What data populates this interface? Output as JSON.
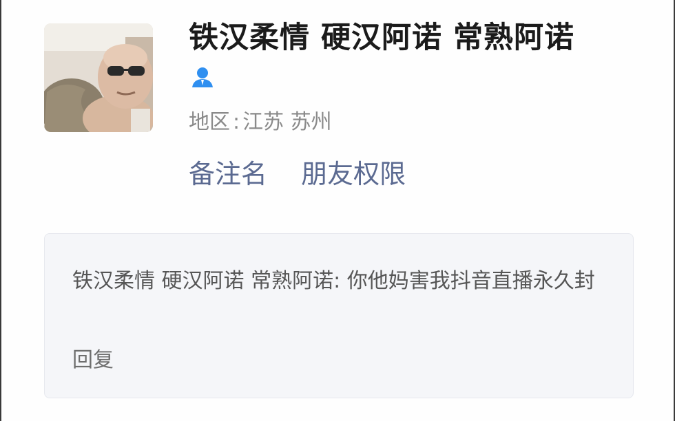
{
  "profile": {
    "avatar_icon": "user-avatar-photo",
    "name": "铁汉柔情 硬汉阿诺 常熟阿诺",
    "gender_icon": "person-icon",
    "gender_color": "#2f8ff0",
    "region_label": "地区",
    "region_sep": ":",
    "region_value": "江苏 苏州"
  },
  "actions": {
    "remark": "备注名",
    "permission": "朋友权限"
  },
  "message_card": {
    "text": "铁汉柔情 硬汉阿诺 常熟阿诺: 你他妈害我抖音直播永久封",
    "reply": "回复"
  },
  "colors": {
    "link": "#5b6a91",
    "card_bg": "#f5f6f9"
  }
}
